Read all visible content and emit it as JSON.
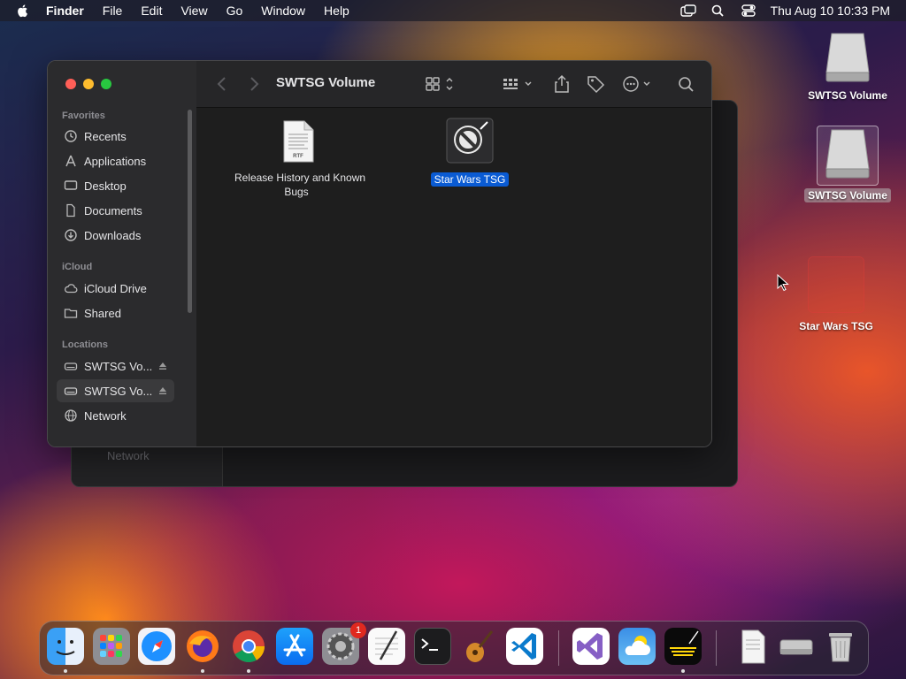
{
  "menubar": {
    "app": "Finder",
    "items": [
      "File",
      "Edit",
      "View",
      "Go",
      "Window",
      "Help"
    ],
    "clock": "Thu Aug 10  10:33 PM"
  },
  "finder": {
    "title": "SWTSG Volume",
    "sidebar": {
      "favorites_header": "Favorites",
      "favorites": [
        "Recents",
        "Applications",
        "Desktop",
        "Documents",
        "Downloads"
      ],
      "icloud_header": "iCloud",
      "icloud": [
        "iCloud Drive",
        "Shared"
      ],
      "locations_header": "Locations",
      "locations": [
        "SWTSG Vo...",
        "SWTSG Vo...",
        "Network"
      ]
    },
    "files": [
      {
        "name": "Release History and Known Bugs",
        "type": "RTF"
      },
      {
        "name": "Star Wars TSG"
      }
    ]
  },
  "background_window": {
    "sidebar_item": "Network"
  },
  "desktop": {
    "icons": [
      {
        "name": "SWTSG Volume"
      },
      {
        "name": "SWTSG Volume"
      },
      {
        "name": "Star Wars TSG"
      }
    ]
  },
  "dock": {
    "settings_badge": "1",
    "apps": [
      "finder-icon",
      "launchpad-icon",
      "safari-icon",
      "firefox-icon",
      "chrome-icon",
      "app-store-icon",
      "system-settings-icon",
      "textedit-icon",
      "terminal-icon",
      "garageband-icon",
      "vscode-icon",
      "visual-studio-icon",
      "weather-icon",
      "star-wars-tsg-icon",
      "rtf-document-icon",
      "disk-image-icon",
      "trash-icon"
    ]
  },
  "colors": {
    "selection": "#0a5bd3",
    "close": "#ff5f57",
    "minimize": "#febc2e",
    "zoom": "#28c840"
  }
}
